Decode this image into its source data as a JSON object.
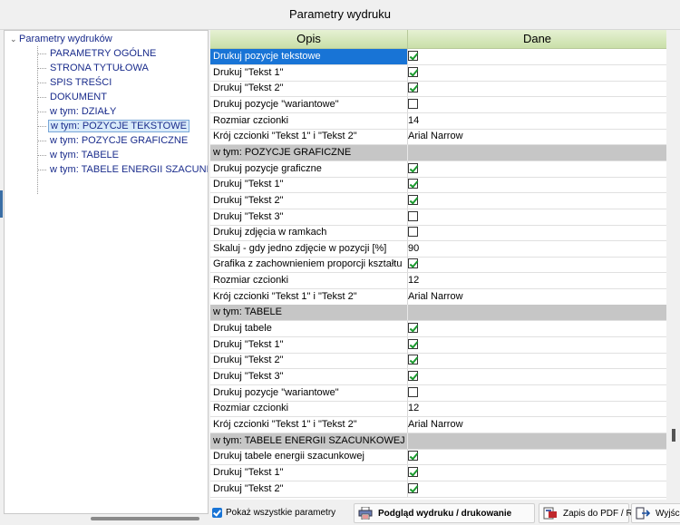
{
  "window": {
    "title": "Parametry wydruku"
  },
  "tree": {
    "root": "Parametry wydruków",
    "items": [
      {
        "label": "PARAMETRY OGÓLNE"
      },
      {
        "label": "STRONA TYTUŁOWA"
      },
      {
        "label": "SPIS TREŚCI"
      },
      {
        "label": "DOKUMENT"
      },
      {
        "label": "w tym: DZIAŁY"
      },
      {
        "label": "w tym: POZYCJE TEKSTOWE",
        "selected": true
      },
      {
        "label": "w tym: POZYCJE GRAFICZNE"
      },
      {
        "label": "w tym: TABELE"
      },
      {
        "label": "w tym: TABELE ENERGII SZACUNKOWEJ"
      }
    ]
  },
  "grid": {
    "columns": [
      "Opis",
      "Dane"
    ],
    "rows": [
      {
        "label": "Drukuj pozycje tekstowe",
        "type": "check",
        "value": true,
        "active": true
      },
      {
        "label": "Drukuj \"Tekst 1\"",
        "type": "check",
        "value": true
      },
      {
        "label": "Drukuj \"Tekst 2\"",
        "type": "check",
        "value": true
      },
      {
        "label": "Drukuj pozycje \"wariantowe\"",
        "type": "check",
        "value": false
      },
      {
        "label": "Rozmiar czcionki",
        "type": "text",
        "value": "14"
      },
      {
        "label": "Krój czcionki \"Tekst 1\" i \"Tekst 2\"",
        "type": "text",
        "value": "Arial Narrow"
      },
      {
        "label": "w tym: POZYCJE GRAFICZNE",
        "type": "section"
      },
      {
        "label": "Drukuj pozycje graficzne",
        "type": "check",
        "value": true
      },
      {
        "label": "Drukuj \"Tekst 1\"",
        "type": "check",
        "value": true
      },
      {
        "label": "Drukuj \"Tekst 2\"",
        "type": "check",
        "value": true
      },
      {
        "label": "Drukuj \"Tekst 3\"",
        "type": "check",
        "value": false
      },
      {
        "label": "Drukuj zdjęcia w ramkach",
        "type": "check",
        "value": false
      },
      {
        "label": "Skaluj - gdy jedno zdjęcie w pozycji [%]",
        "type": "text",
        "value": "90"
      },
      {
        "label": "Grafika z zachownieniem proporcji kształtu",
        "type": "check",
        "value": true
      },
      {
        "label": "Rozmiar czcionki",
        "type": "text",
        "value": "12"
      },
      {
        "label": "Krój czcionki \"Tekst 1\" i \"Tekst 2\"",
        "type": "text",
        "value": "Arial Narrow"
      },
      {
        "label": "w tym: TABELE",
        "type": "section"
      },
      {
        "label": "Drukuj tabele",
        "type": "check",
        "value": true
      },
      {
        "label": "Drukuj \"Tekst 1\"",
        "type": "check",
        "value": true
      },
      {
        "label": "Drukuj \"Tekst 2\"",
        "type": "check",
        "value": true
      },
      {
        "label": "Drukuj \"Tekst 3\"",
        "type": "check",
        "value": true
      },
      {
        "label": "Drukuj pozycje \"wariantowe\"",
        "type": "check",
        "value": false
      },
      {
        "label": "Rozmiar czcionki",
        "type": "text",
        "value": "12"
      },
      {
        "label": "Krój czcionki \"Tekst 1\" i \"Tekst 2\"",
        "type": "text",
        "value": "Arial Narrow"
      },
      {
        "label": "w tym: TABELE ENERGII SZACUNKOWEJ",
        "type": "section"
      },
      {
        "label": "Drukuj tabele energii szacunkowej",
        "type": "check",
        "value": true
      },
      {
        "label": "Drukuj \"Tekst 1\"",
        "type": "check",
        "value": true
      },
      {
        "label": "Drukuj \"Tekst 2\"",
        "type": "check",
        "value": true
      }
    ]
  },
  "bottom": {
    "show_all_label": "Pokaż wszystkie parametry",
    "show_all_checked": true,
    "preview_label": "Podgląd wydruku / drukowanie",
    "pdf_label": "Zapis do PDF / RTF",
    "exit_label": "Wyjście"
  },
  "colors": {
    "header_green": "#c9dfa8",
    "selection_blue": "#1874d6",
    "section_gray": "#c6c6c6",
    "check_green": "#1a9a2e"
  }
}
